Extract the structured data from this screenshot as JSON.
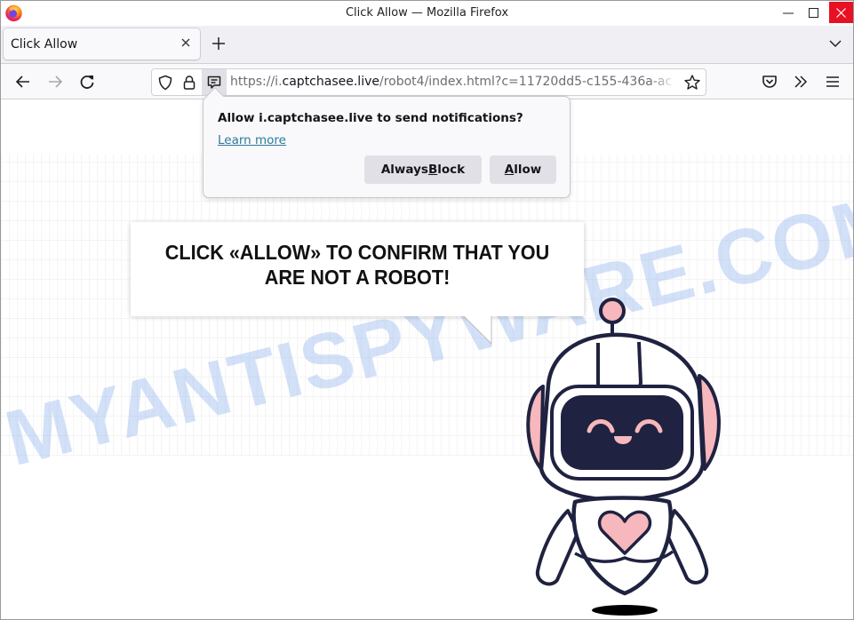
{
  "window": {
    "title": "Click Allow — Mozilla Firefox",
    "controls": {
      "minimize": "minimize",
      "maximize": "maximize",
      "close": "close"
    },
    "close_color": "#e81123"
  },
  "tabs": [
    {
      "label": "Click Allow",
      "active": true
    }
  ],
  "navbar": {
    "url_prefix": "https://i.",
    "url_domain": "captchasee.live",
    "url_path": "/robot4/index.html?c=11720dd5-c155-436a-ac",
    "icons": [
      "back-icon",
      "forward-icon",
      "reload-icon",
      "shield-icon",
      "lock-icon",
      "notification-permission-icon",
      "bookmark-star-icon",
      "pocket-icon",
      "overflow-chevrons-icon",
      "hamburger-menu-icon"
    ]
  },
  "notification": {
    "title": "Allow i.captchasee.live to send notifications?",
    "learn_more": "Learn more",
    "block_pre": "Always ",
    "block_key": "B",
    "block_post": "lock",
    "allow_key": "A",
    "allow_post": "llow",
    "link_color": "#2b7a9c"
  },
  "page": {
    "bubble_line1": "CLICK «ALLOW» TO CONFIRM THAT YOU",
    "bubble_line2": "ARE NOT A ROBOT!",
    "watermark": "MYANTISPYWARE.COM",
    "robot_colors": {
      "outline": "#1f2240",
      "pink": "#f6b8bc",
      "visor": "#1f2240"
    }
  }
}
